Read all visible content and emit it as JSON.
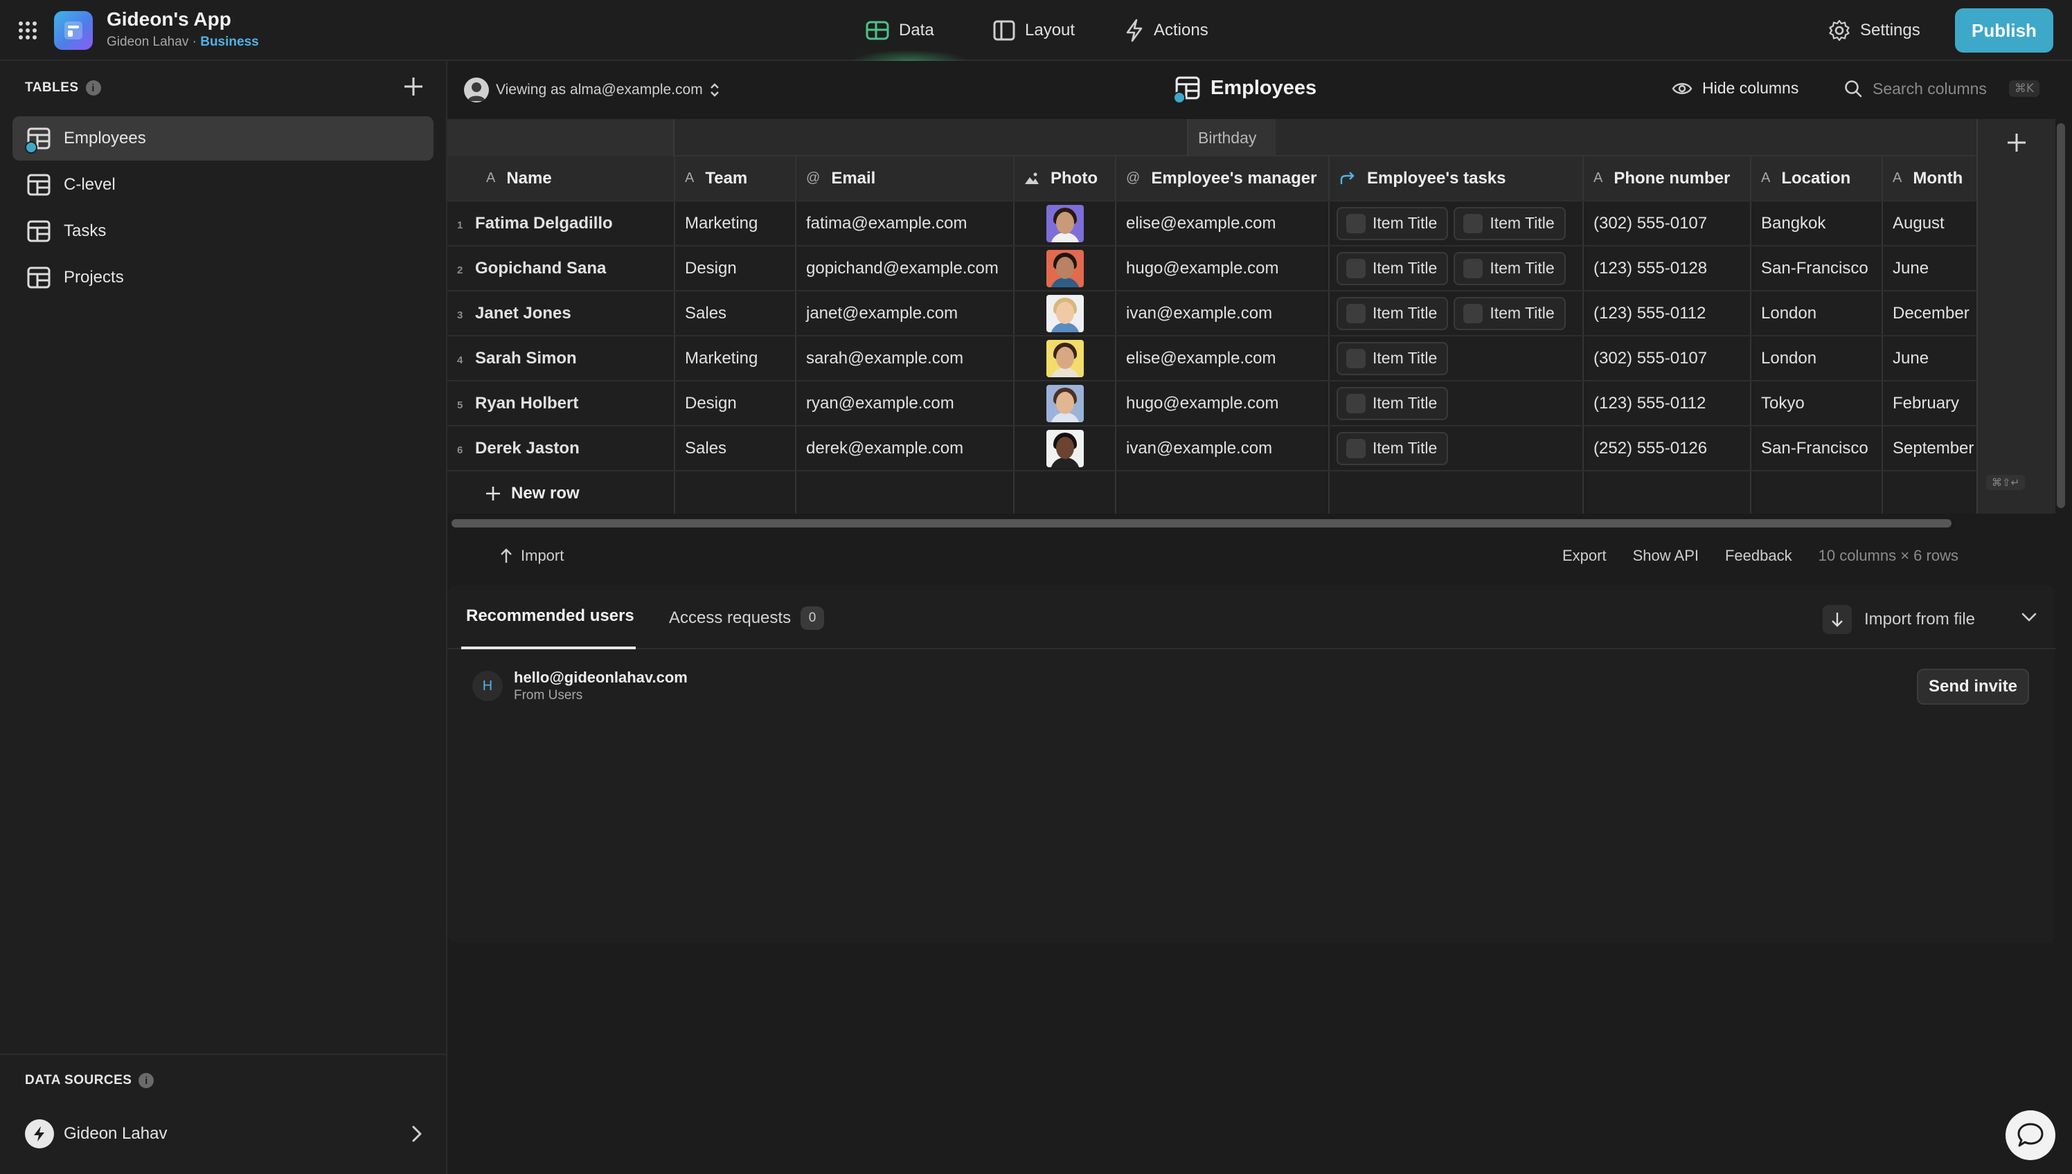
{
  "app": {
    "name": "Gideon's App",
    "owner": "Gideon Lahav",
    "separator": "·",
    "plan": "Business"
  },
  "nav": {
    "data": "Data",
    "layout": "Layout",
    "actions": "Actions",
    "settings": "Settings",
    "publish": "Publish"
  },
  "sidebar": {
    "tables_title": "TABLES",
    "tables": [
      {
        "label": "Employees"
      },
      {
        "label": "C-level"
      },
      {
        "label": "Tasks"
      },
      {
        "label": "Projects"
      }
    ],
    "sources_title": "DATA SOURCES",
    "source": {
      "label": "Gideon Lahav"
    },
    "info": "i"
  },
  "header": {
    "viewing_as": "Viewing as alma@example.com",
    "title": "Employees",
    "hide_columns": "Hide columns",
    "search_placeholder": "Search columns",
    "search_shortcut": "⌘K"
  },
  "table": {
    "group_header": "Birthday",
    "columns": [
      "Name",
      "Team",
      "Email",
      "Photo",
      "Employee's manager",
      "Employee's tasks",
      "Phone number",
      "Location",
      "Month"
    ],
    "column_glyphs": {
      "text": "A",
      "email": "@"
    },
    "chip_label": "Item Title",
    "rows": [
      {
        "num": "1",
        "name": "Fatima Delgadillo",
        "team": "Marketing",
        "email": "fatima@example.com",
        "manager": "elise@example.com",
        "tasks": 2,
        "phone": "(302) 555-0107",
        "location": "Bangkok",
        "month": "August",
        "photo_bg": "#7d6fd9",
        "skin": "#c99a77",
        "hair": "#2a1a12",
        "shirt": "#f1f1f1"
      },
      {
        "num": "2",
        "name": "Gopichand Sana",
        "team": "Design",
        "email": "gopichand@example.com",
        "manager": "hugo@example.com",
        "tasks": 2,
        "phone": "(123) 555-0128",
        "location": "San-Francisco",
        "month": "June",
        "photo_bg": "#e26a4e",
        "skin": "#b98262",
        "hair": "#1f1512",
        "shirt": "#2f5e88"
      },
      {
        "num": "3",
        "name": "Janet Jones",
        "team": "Sales",
        "email": "janet@example.com",
        "manager": "ivan@example.com",
        "tasks": 2,
        "phone": "(123) 555-0112",
        "location": "London",
        "month": "December",
        "photo_bg": "#eef0f4",
        "skin": "#f0c9a6",
        "hair": "#d9b77a",
        "shirt": "#5b8bc0"
      },
      {
        "num": "4",
        "name": "Sarah Simon",
        "team": "Marketing",
        "email": "sarah@example.com",
        "manager": "elise@example.com",
        "tasks": 1,
        "phone": "(302) 555-0107",
        "location": "London",
        "month": "June",
        "photo_bg": "#f3dc6b",
        "skin": "#d8a883",
        "hair": "#3a2418",
        "shirt": "#e9e2d0"
      },
      {
        "num": "5",
        "name": "Ryan Holbert",
        "team": "Design",
        "email": "ryan@example.com",
        "manager": "hugo@example.com",
        "tasks": 1,
        "phone": "(123) 555-0112",
        "location": "Tokyo",
        "month": "February",
        "photo_bg": "#9bb3d9",
        "skin": "#e2b593",
        "hair": "#4a3222",
        "shirt": "#dfe5ee"
      },
      {
        "num": "6",
        "name": "Derek Jaston",
        "team": "Sales",
        "email": "derek@example.com",
        "manager": "ivan@example.com",
        "tasks": 1,
        "phone": "(252) 555-0126",
        "location": "San-Francisco",
        "month": "September",
        "photo_bg": "#f1f1f1",
        "skin": "#6b4330",
        "hair": "#161010",
        "shirt": "#222222"
      }
    ],
    "new_row": "New row",
    "add_row_shortcut": "⌘⇧↵"
  },
  "footer": {
    "import": "Import",
    "export": "Export",
    "show_api": "Show API",
    "feedback": "Feedback",
    "stats": "10 columns × 6 rows"
  },
  "users_panel": {
    "tab_recommended": "Recommended users",
    "tab_requests": "Access requests",
    "requests_count": "0",
    "import_from_file": "Import from file",
    "user": {
      "initial": "H",
      "email": "hello@gideonlahav.com",
      "source": "From Users"
    },
    "send_invite": "Send invite"
  },
  "colors": {
    "accent": "#3ea8c9",
    "plan": "#4fb3e6",
    "data_tab_icon": "#4cc38a"
  },
  "icons": {
    "apps": "grid-icon",
    "data": "table-icon",
    "layout": "layout-icon",
    "actions": "bolt-icon",
    "settings": "gear-icon",
    "hide": "eye-icon",
    "search": "search-icon",
    "chat": "chat-icon"
  }
}
